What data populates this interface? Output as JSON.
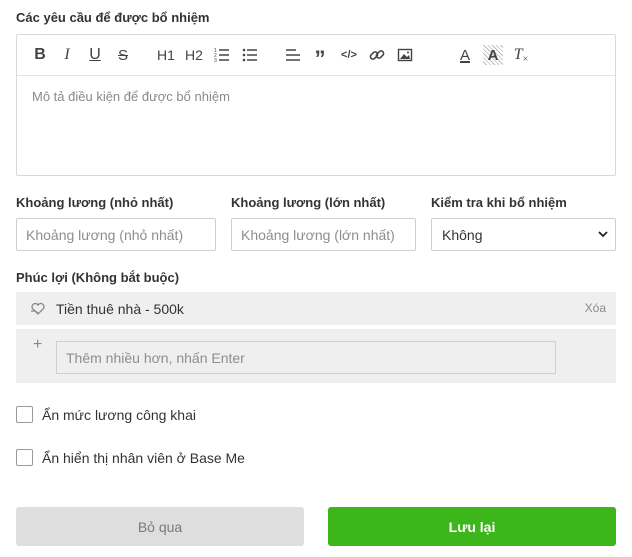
{
  "requirements": {
    "label": "Các yêu cầu để được bổ nhiệm",
    "placeholder": "Mô tả điều kiện để được bổ nhiệm",
    "toolbar": [
      {
        "icon": "bold-icon",
        "glyph": "B"
      },
      {
        "icon": "italic-icon",
        "glyph": "I"
      },
      {
        "icon": "underline-icon",
        "glyph": "U"
      },
      {
        "icon": "strikethrough-icon",
        "glyph": "S"
      },
      {
        "icon": "heading-1-icon",
        "glyph": "H1"
      },
      {
        "icon": "heading-2-icon",
        "glyph": "H2"
      },
      {
        "icon": "ordered-list-icon",
        "glyph": ""
      },
      {
        "icon": "bullet-list-icon",
        "glyph": ""
      },
      {
        "icon": "align-icon",
        "glyph": ""
      },
      {
        "icon": "quote-icon",
        "glyph": "”"
      },
      {
        "icon": "code-icon",
        "glyph": "</>"
      },
      {
        "icon": "link-icon",
        "glyph": ""
      },
      {
        "icon": "image-icon",
        "glyph": ""
      },
      {
        "icon": "text-color-icon",
        "glyph": "A"
      },
      {
        "icon": "highlight-icon",
        "glyph": "A"
      },
      {
        "icon": "clear-format-icon",
        "glyph": "T"
      }
    ]
  },
  "salary_min": {
    "label": "Khoảng lương (nhỏ nhất)",
    "placeholder": "Khoảng lương (nhỏ nhất)"
  },
  "salary_max": {
    "label": "Khoảng lương (lớn nhất)",
    "placeholder": "Khoảng lương (lớn nhất)"
  },
  "check_on_appoint": {
    "label": "Kiểm tra khi bổ nhiệm",
    "selected": "Không"
  },
  "benefits": {
    "label": "Phúc lợi (Không bắt buộc)",
    "items": [
      {
        "text": "Tiền thuê nhà - 500k",
        "delete_label": "Xóa"
      }
    ],
    "add_icon": "+",
    "add_placeholder": "Thêm nhiều hơn, nhấn Enter"
  },
  "options": {
    "hide_salary": "Ẩn mức lương công khai",
    "hide_employee": "Ẩn hiển thị nhân viên ở Base Me"
  },
  "buttons": {
    "skip": "Bỏ qua",
    "save": "Lưu lại"
  },
  "colors": {
    "save_button": "#3db61b",
    "skip_button": "#dedede",
    "benefit_background": "#efefef"
  }
}
